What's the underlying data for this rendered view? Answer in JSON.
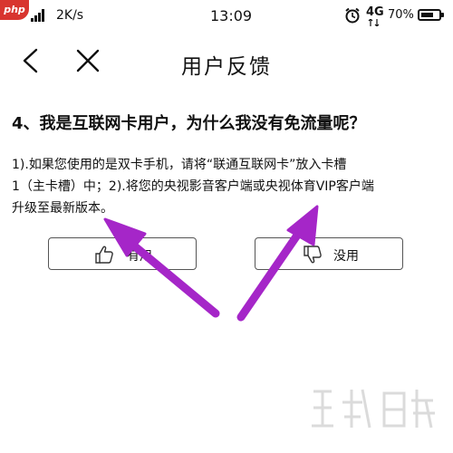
{
  "status_bar": {
    "network_speed": "2K/s",
    "time": "13:09",
    "network_type": "4G",
    "battery_percent": "70%",
    "battery_level": 0.7,
    "badge": "php"
  },
  "header": {
    "title": "用户反馈",
    "back_icon": "chevron-left-icon",
    "close_icon": "close-icon"
  },
  "content": {
    "question": "4、我是互联网卡用户，为什么我没有免流量呢？",
    "answer_lines": [
      "1).如果您使用的是双卡手机，请将“联通互联网卡”放入卡槽",
      "1（主卡槽）中；2).将您的央视影音客户端或央视体育VIP客户端",
      "升级至最新版本。"
    ]
  },
  "feedback": {
    "useful_label": "有用",
    "useless_label": "没用",
    "useful_icon": "thumbs-up-icon",
    "useless_icon": "thumbs-down-icon"
  },
  "annotation": {
    "arrow_color": "#a526c8"
  }
}
